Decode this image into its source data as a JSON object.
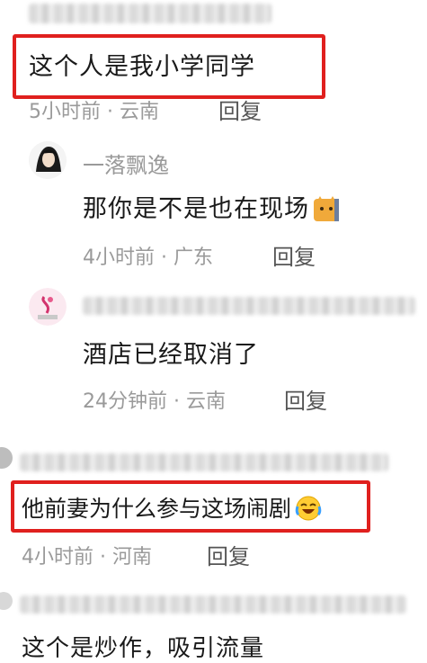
{
  "comments": [
    {
      "text": "这个人是我小学同学",
      "time": "5小时前",
      "location": "云南",
      "reply_label": "回复"
    },
    {
      "username": "一落飘逸",
      "text": "那你是不是也在现场",
      "emoji": "cat-emoji",
      "time": "4小时前",
      "location": "广东",
      "reply_label": "回复"
    },
    {
      "text": "酒店已经取消了",
      "time": "24分钟前",
      "location": "云南",
      "reply_label": "回复"
    },
    {
      "text": "他前妻为什么参与这场闹剧",
      "emoji": "laughing-tears-emoji",
      "time": "4小时前",
      "location": "河南",
      "reply_label": "回复"
    },
    {
      "text": "这个是炒作，吸引流量"
    }
  ],
  "meta_separator": " · ",
  "colors": {
    "highlight_box": "#e0201e",
    "meta_text": "#9a9a9a"
  }
}
